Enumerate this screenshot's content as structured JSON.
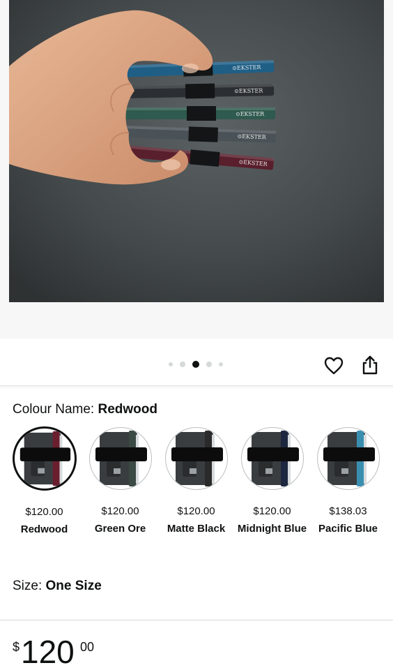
{
  "hero": {
    "image_alt": "Hand holding five coloured card holder wallets",
    "wallet_brand": "EKSTER",
    "wallet_colors": [
      "#1f5f86",
      "#2b2f33",
      "#2f5a4e",
      "#4a5258",
      "#5a1f2c"
    ]
  },
  "gallery": {
    "page_count": 5,
    "active_index": 2
  },
  "actions": {
    "favourite_icon": "heart-icon",
    "share_icon": "share-icon"
  },
  "colour": {
    "label": "Colour Name:",
    "selected": "Redwood",
    "options": [
      {
        "price": "$120.00",
        "name": "Redwood",
        "accent": "#6b1e2e",
        "selected": true
      },
      {
        "price": "$120.00",
        "name": "Green Ore",
        "accent": "#3b4a44",
        "selected": false
      },
      {
        "price": "$120.00",
        "name": "Matte Black",
        "accent": "#2a2a2a",
        "selected": false
      },
      {
        "price": "$120.00",
        "name": "Midnight Blue",
        "accent": "#1e2740",
        "selected": false
      },
      {
        "price": "$138.03",
        "name": "Pacific Blue",
        "accent": "#3a8fb0",
        "selected": false
      }
    ]
  },
  "size": {
    "label": "Size:",
    "value": "One Size"
  },
  "price": {
    "currency": "$",
    "whole": "120",
    "fraction": "00"
  }
}
